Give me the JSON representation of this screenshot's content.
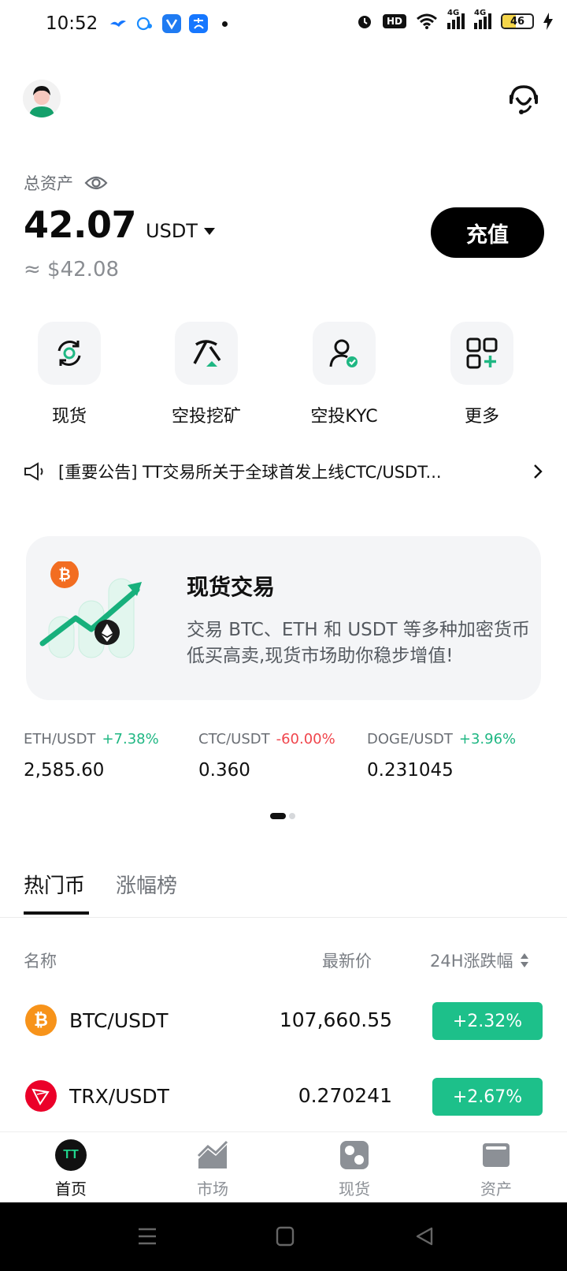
{
  "status_bar": {
    "time": "10:52",
    "battery": "46",
    "signal_labels": [
      "HD",
      "4G",
      "4G"
    ]
  },
  "header": {
    "total_assets_label": "总资产",
    "balance": "42.07",
    "unit": "USDT",
    "approx_value": "≈ $42.08",
    "deposit_label": "充值"
  },
  "quick_actions": [
    {
      "label": "现货",
      "icon": "spot-exchange-icon"
    },
    {
      "label": "空投挖矿",
      "icon": "pickaxe-icon"
    },
    {
      "label": "空投KYC",
      "icon": "user-verify-icon"
    },
    {
      "label": "更多",
      "icon": "grid-plus-icon"
    }
  ],
  "announcement": {
    "text": "[重要公告] TT交易所关于全球首发上线CTC/USDT..."
  },
  "banner": {
    "title": "现货交易",
    "description": "交易 BTC、ETH 和 USDT 等多种加密货币低买高卖,现货市场助你稳步增值!"
  },
  "tickers": [
    {
      "pair": "ETH/USDT",
      "change": "+7.38%",
      "price": "2,585.60",
      "direction": "up"
    },
    {
      "pair": "CTC/USDT",
      "change": "-60.00%",
      "price": "0.360",
      "direction": "down"
    },
    {
      "pair": "DOGE/USDT",
      "change": "+3.96%",
      "price": "0.231045",
      "direction": "up"
    }
  ],
  "tabs": {
    "hot": "热门币",
    "gainers": "涨幅榜"
  },
  "table": {
    "col_name": "名称",
    "col_price": "最新价",
    "col_change": "24H涨跌幅",
    "rows": [
      {
        "pair": "BTC/USDT",
        "price": "107,660.55",
        "change": "+2.32%",
        "icon": "btc-icon"
      },
      {
        "pair": "TRX/USDT",
        "price": "0.270241",
        "change": "+2.67%",
        "icon": "trx-icon"
      }
    ]
  },
  "bottom_nav": [
    {
      "label": "首页",
      "icon": "tt-logo-icon",
      "active": true
    },
    {
      "label": "市场",
      "icon": "market-chart-icon",
      "active": false
    },
    {
      "label": "现货",
      "icon": "spot-icon",
      "active": false
    },
    {
      "label": "资产",
      "icon": "wallet-icon",
      "active": false
    }
  ],
  "brand": {
    "logo_text": "TT"
  },
  "colors": {
    "up": "#1fb783",
    "down": "#f0454c",
    "pill_green": "#1dc08a",
    "primary_button": "#000000"
  }
}
